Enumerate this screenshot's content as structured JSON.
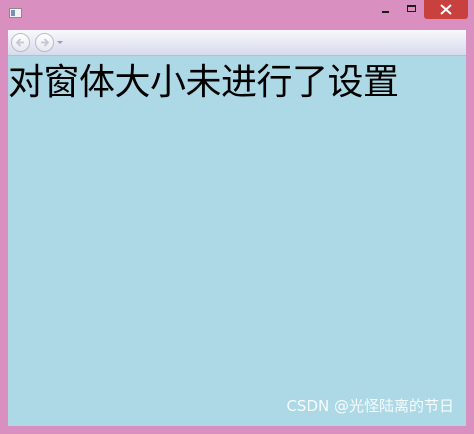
{
  "window": {
    "title": "",
    "colors": {
      "frame": "#d98fc0",
      "client_background": "#add8e6",
      "close_button": "#c9413f"
    }
  },
  "navigation": {
    "back_icon": "back-arrow-icon",
    "forward_icon": "forward-arrow-icon",
    "dropdown_icon": "chevron-down-icon"
  },
  "content": {
    "text": "对窗体大小未进行了设置"
  },
  "watermark": {
    "text": "CSDN @光怪陆离的节日"
  }
}
